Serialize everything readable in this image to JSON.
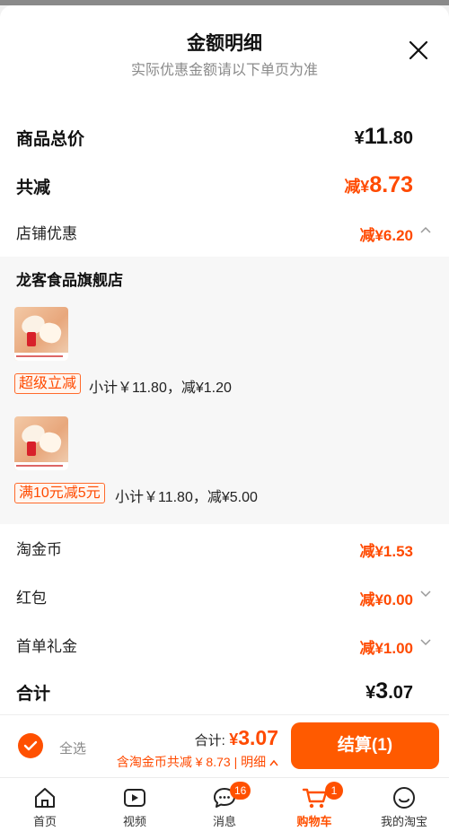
{
  "header": {
    "title": "金额明细",
    "subtitle": "实际优惠金额请以下单页为准"
  },
  "summary": {
    "goods_total_label": "商品总价",
    "goods_total_currency": "¥",
    "goods_total_int": "11",
    "goods_total_dec": ".80",
    "total_reduce_label": "共减",
    "total_reduce_prefix": "减¥",
    "total_reduce_value": "8.73",
    "shop_discount_label": "店铺优惠",
    "shop_discount_value": "减¥6.20"
  },
  "shop": {
    "name": "龙客食品旗舰店",
    "items": [
      {
        "tag": "超级立减",
        "subtotal": "小计￥11.80，减¥1.20"
      },
      {
        "tag": "满10元减5元",
        "subtotal": "小计￥11.80，减¥5.00"
      }
    ]
  },
  "other_discounts": {
    "coin_label": "淘金币",
    "coin_value": "减¥1.53",
    "redpacket_label": "红包",
    "redpacket_value": "减¥0.00",
    "firstorder_label": "首单礼金",
    "firstorder_value": "减¥1.00"
  },
  "total": {
    "label": "合计",
    "currency": "¥",
    "int": "3",
    "dec": ".07"
  },
  "checkout": {
    "select_all": "全选",
    "total_label": "合计:",
    "total_currency": "¥",
    "total_value": "3.07",
    "discount_line": "含淘金币共减 ¥ 8.73",
    "detail_link": "| 明细",
    "pay_button": "结算(1)"
  },
  "tabbar": {
    "tabs": [
      {
        "label": "首页",
        "icon": "home-icon"
      },
      {
        "label": "视频",
        "icon": "video-icon"
      },
      {
        "label": "消息",
        "icon": "message-icon",
        "badge": "16"
      },
      {
        "label": "购物车",
        "icon": "cart-icon",
        "badge": "1"
      },
      {
        "label": "我的淘宝",
        "icon": "profile-icon"
      }
    ]
  },
  "colors": {
    "accent": "#ff5000",
    "discount": "#ff4a00",
    "panel": "#f7f7f7"
  }
}
